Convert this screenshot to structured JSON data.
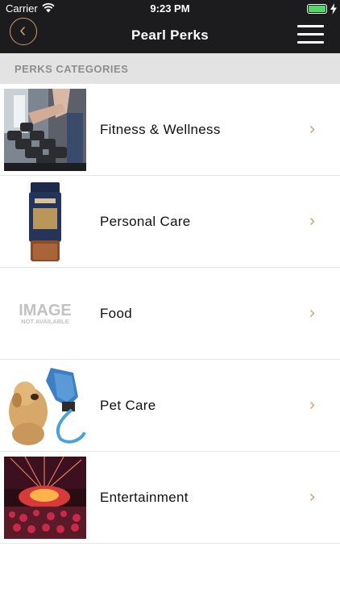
{
  "status_bar": {
    "carrier": "Carrier",
    "time": "9:23 PM",
    "battery_color": "#4cd964"
  },
  "navbar": {
    "title": "Pearl Perks",
    "back_icon": "chevron-left-icon",
    "menu_icon": "hamburger-menu-icon",
    "accent": "#c8a063"
  },
  "section": {
    "header": "PERKS CATEGORIES"
  },
  "categories": [
    {
      "label": "Fitness & Wellness",
      "image": "dumbbell-rack-photo"
    },
    {
      "label": "Personal Care",
      "image": "coffee-jar-photo"
    },
    {
      "label": "Food",
      "image": "image-not-available-placeholder",
      "placeholder_title": "IMAGE",
      "placeholder_sub": "NOT AVAILABLE"
    },
    {
      "label": "Pet Care",
      "image": "dog-grooming-glove-photo"
    },
    {
      "label": "Entertainment",
      "image": "concert-stage-photo"
    }
  ]
}
